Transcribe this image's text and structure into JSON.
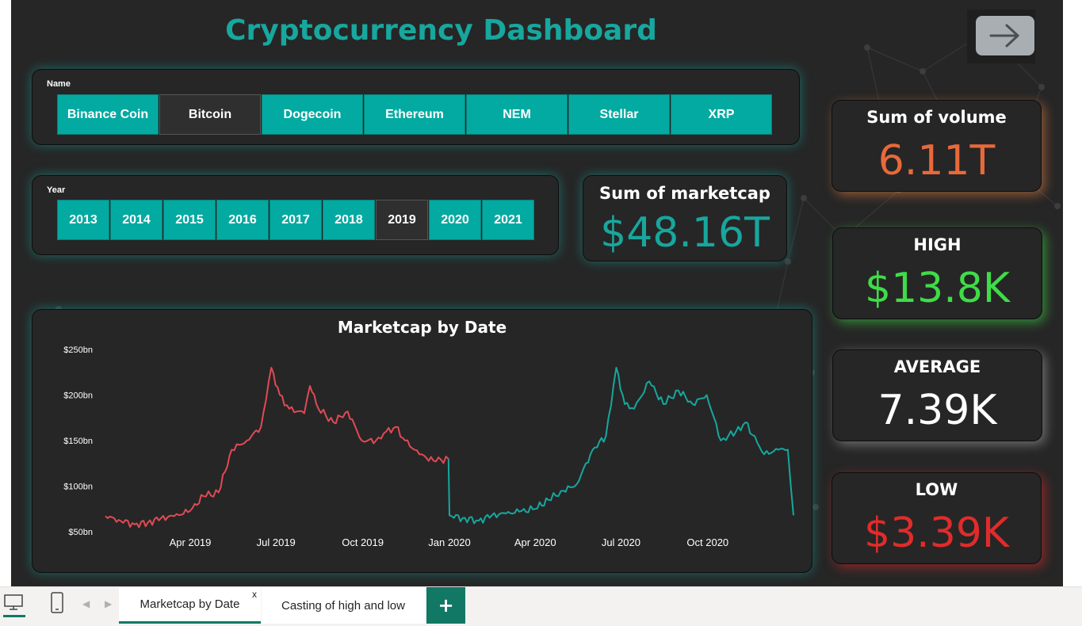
{
  "dashboard": {
    "title": "Cryptocurrency Dashboard"
  },
  "name_slicer": {
    "label": "Name",
    "items": [
      "Binance Coin",
      "Bitcoin",
      "Dogecoin",
      "Ethereum",
      "NEM",
      "Stellar",
      "XRP"
    ],
    "selected": "Bitcoin"
  },
  "year_slicer": {
    "label": "Year",
    "items": [
      "2013",
      "2014",
      "2015",
      "2016",
      "2017",
      "2018",
      "2019",
      "2020",
      "2021"
    ],
    "selected": "2019"
  },
  "cards": {
    "marketcap": {
      "title": "Sum of marketcap",
      "value": "$48.16T",
      "color": "#17a79e"
    },
    "volume": {
      "title": "Sum of volume",
      "value": "6.11T",
      "color": "#e8693a"
    },
    "high": {
      "title": "HIGH",
      "value": "$13.8K",
      "color": "#3fdc48"
    },
    "average": {
      "title": "AVERAGE",
      "value": "7.39K",
      "color": "#ffffff"
    },
    "low": {
      "title": "LOW",
      "value": "$3.39K",
      "color": "#e12b2b"
    }
  },
  "chart_data": {
    "type": "line",
    "title": "Marketcap by Date",
    "xlabel": "",
    "ylabel": "",
    "y_ticks": [
      "$50bn",
      "$100bn",
      "$150bn",
      "$200bn",
      "$250bn"
    ],
    "x_ticks": [
      "Apr 2019",
      "Jul 2019",
      "Oct 2019",
      "Jan 2020",
      "Apr 2020",
      "Jul 2020",
      "Oct 2020"
    ],
    "ylim": [
      50,
      250
    ],
    "xlim": [
      "2019-01-01",
      "2020-12-31"
    ],
    "series": [
      {
        "color": "#e04a55",
        "points": [
          [
            "2019-01-01",
            67
          ],
          [
            "2019-01-15",
            63
          ],
          [
            "2019-02-01",
            58
          ],
          [
            "2019-02-15",
            60
          ],
          [
            "2019-03-01",
            65
          ],
          [
            "2019-03-15",
            67
          ],
          [
            "2019-04-01",
            73
          ],
          [
            "2019-04-15",
            89
          ],
          [
            "2019-05-01",
            93
          ],
          [
            "2019-05-15",
            140
          ],
          [
            "2019-05-31",
            150
          ],
          [
            "2019-06-15",
            165
          ],
          [
            "2019-06-26",
            230
          ],
          [
            "2019-07-05",
            200
          ],
          [
            "2019-07-15",
            185
          ],
          [
            "2019-07-31",
            180
          ],
          [
            "2019-08-06",
            210
          ],
          [
            "2019-08-15",
            185
          ],
          [
            "2019-08-31",
            170
          ],
          [
            "2019-09-15",
            182
          ],
          [
            "2019-09-30",
            150
          ],
          [
            "2019-10-15",
            150
          ],
          [
            "2019-10-26",
            160
          ],
          [
            "2019-11-05",
            165
          ],
          [
            "2019-11-15",
            150
          ],
          [
            "2019-11-30",
            135
          ],
          [
            "2019-12-15",
            128
          ],
          [
            "2019-12-31",
            130
          ]
        ]
      },
      {
        "color": "#17a79e",
        "points": [
          [
            "2019-12-31",
            130
          ],
          [
            "2020-01-01",
            68
          ],
          [
            "2020-01-15",
            65
          ],
          [
            "2020-02-01",
            62
          ],
          [
            "2020-02-15",
            68
          ],
          [
            "2020-03-01",
            70
          ],
          [
            "2020-03-15",
            72
          ],
          [
            "2020-04-01",
            75
          ],
          [
            "2020-04-15",
            85
          ],
          [
            "2020-05-01",
            95
          ],
          [
            "2020-05-15",
            102
          ],
          [
            "2020-06-01",
            140
          ],
          [
            "2020-06-15",
            155
          ],
          [
            "2020-06-26",
            230
          ],
          [
            "2020-07-05",
            190
          ],
          [
            "2020-07-15",
            185
          ],
          [
            "2020-07-31",
            215
          ],
          [
            "2020-08-15",
            190
          ],
          [
            "2020-08-31",
            205
          ],
          [
            "2020-09-15",
            190
          ],
          [
            "2020-09-30",
            200
          ],
          [
            "2020-10-15",
            150
          ],
          [
            "2020-10-31",
            160
          ],
          [
            "2020-11-10",
            170
          ],
          [
            "2020-11-30",
            135
          ],
          [
            "2020-12-15",
            140
          ],
          [
            "2020-12-25",
            140
          ],
          [
            "2020-12-31",
            68
          ]
        ]
      }
    ]
  },
  "bottom_tabs": {
    "items": [
      {
        "label": "Marketcap by Date",
        "active": true,
        "close": "x"
      },
      {
        "label": "Casting of high and low",
        "active": false
      }
    ],
    "add_label": "+"
  },
  "colors": {
    "accent": "#17a79e",
    "background": "#262626",
    "tab_accent": "#117865"
  }
}
